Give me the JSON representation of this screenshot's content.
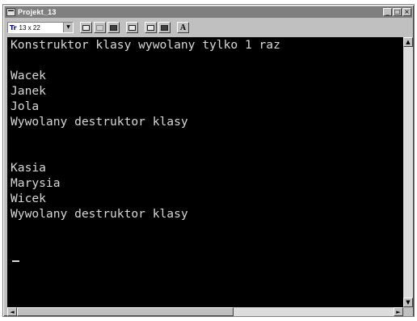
{
  "window": {
    "title": "Projekt_13",
    "buttons": {
      "minimize": "_",
      "maximize": "□",
      "close": "×"
    }
  },
  "toolbar": {
    "font_size": "13 x 22",
    "font_icon": "Tr",
    "dropdown_glyph": "▼",
    "tools": [
      "mark-icon",
      "copy-icon",
      "paste-icon",
      "fullscreen-icon",
      "properties-icon",
      "background-icon",
      "font-icon"
    ],
    "font_button_label": "A"
  },
  "console": {
    "lines": [
      "Konstruktor klasy wywolany tylko 1 raz",
      "",
      "Wacek",
      "Janek",
      "Jola",
      "Wywolany destruktor klasy",
      "",
      "",
      "Kasia",
      "Marysia",
      "Wicek",
      "Wywolany destruktor klasy"
    ]
  },
  "scrollbars": {
    "up": "▲",
    "down": "▼",
    "left": "◄",
    "right": "►",
    "horizontal_position": 0.0
  },
  "colors": {
    "console_bg": "#000000",
    "console_text": "#d8d8d8",
    "titlebar": "#7f7f7f",
    "chrome": "#c0c0c0"
  }
}
